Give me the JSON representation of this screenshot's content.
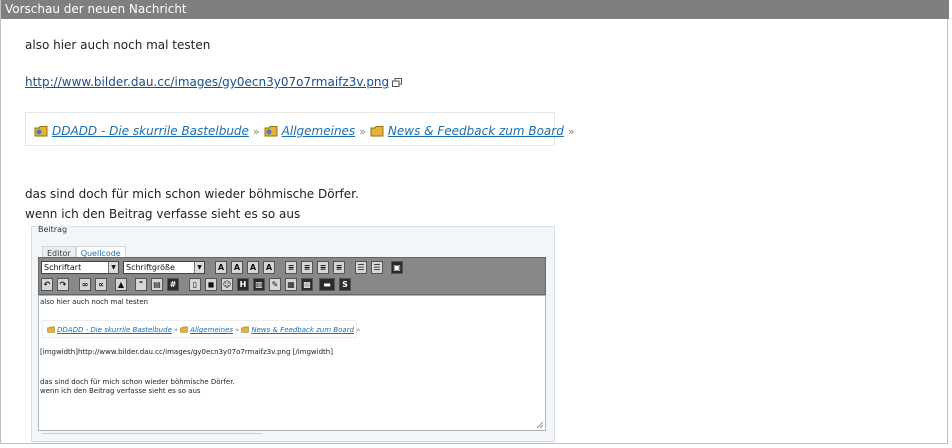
{
  "panel": {
    "title": "Vorschau der neuen Nachricht"
  },
  "message": {
    "line1": "also hier auch noch mal testen",
    "link": "http://www.bilder.dau.cc/images/gy0ecn3y07o7rmaifz3v.png",
    "line2": "das sind doch für mich schon wieder böhmische Dörfer.",
    "line3": "wenn ich den Beitrag verfasse sieht es so aus"
  },
  "breadcrumb": [
    {
      "label": "DDADD - Die skurrile Bastelbude"
    },
    {
      "label": "Allgemeines"
    },
    {
      "label": "News & Feedback zum Board"
    }
  ],
  "breadcrumb_separator": "»",
  "editor": {
    "legend": "Beitrag",
    "tabs": [
      {
        "label": "Editor"
      },
      {
        "label": "Quellcode"
      }
    ],
    "font_select": "Schriftart",
    "size_select": "Schriftgröße",
    "content": {
      "line1": "also hier auch noch mal testen",
      "img_line": "[imgwidth]http://www.bilder.dau.cc/images/gy0ecn3y07o7rmaifz3v.png [/imgwidth]",
      "line2": "das sind doch für mich schon wieder böhmische Dörfer.",
      "line3": "wenn ich den Beitrag verfasse sieht es so aus"
    }
  },
  "colors": {
    "header_bg": "#7f7f7f",
    "link": "#1a4f8b",
    "crumb_link": "#1a6fb0",
    "folder": "#e5b23a"
  }
}
